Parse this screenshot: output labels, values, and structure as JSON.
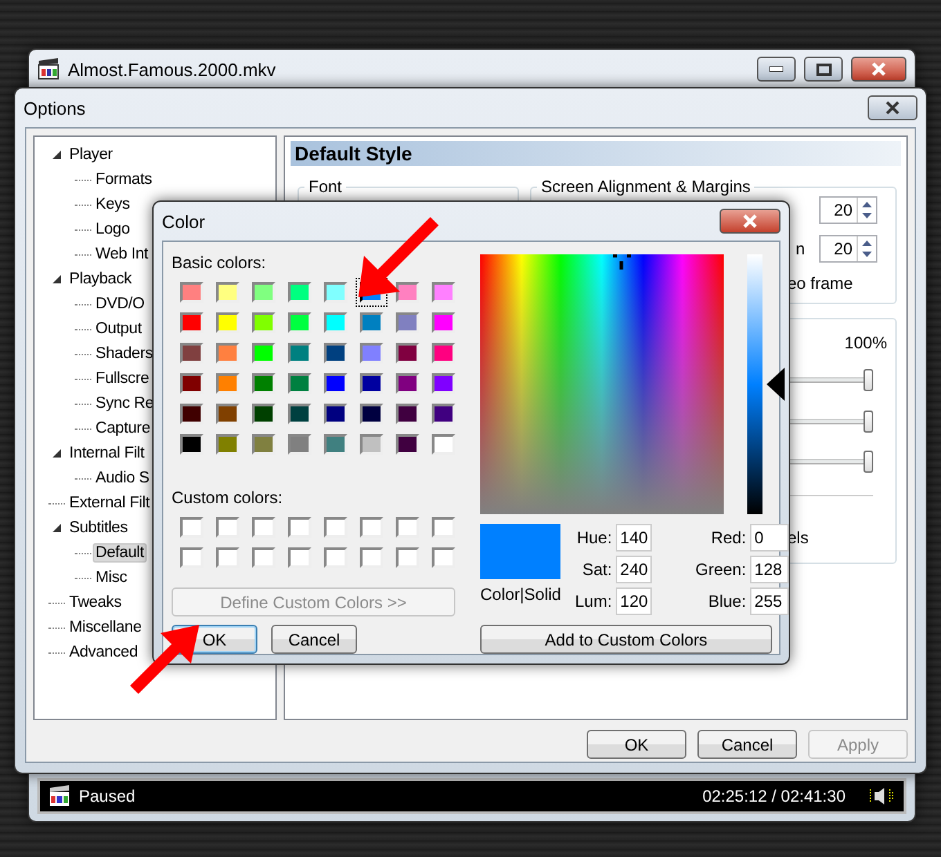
{
  "player_window": {
    "title": "Almost.Famous.2000.mkv",
    "status": "Paused",
    "time": "02:25:12 / 02:41:30"
  },
  "options_window": {
    "title": "Options",
    "tree": [
      {
        "label": "Player",
        "selected": false,
        "expanded": true,
        "children": [
          {
            "label": "Formats",
            "selected": false
          },
          {
            "label": "Keys",
            "selected": false
          },
          {
            "label": "Logo",
            "selected": false
          },
          {
            "label": "Web Int",
            "selected": false
          }
        ]
      },
      {
        "label": "Playback",
        "selected": false,
        "expanded": true,
        "children": [
          {
            "label": "DVD/O",
            "selected": false
          },
          {
            "label": "Output",
            "selected": false
          },
          {
            "label": "Shaders",
            "selected": false
          },
          {
            "label": "Fullscre",
            "selected": false
          },
          {
            "label": "Sync Re",
            "selected": false
          },
          {
            "label": "Capture",
            "selected": false
          }
        ]
      },
      {
        "label": "Internal Filt",
        "selected": false,
        "expanded": true,
        "children": [
          {
            "label": "Audio S",
            "selected": false
          }
        ]
      },
      {
        "label": "External Filt",
        "selected": false
      },
      {
        "label": "Subtitles",
        "selected": false,
        "expanded": true,
        "children": [
          {
            "label": "Default",
            "selected": true
          },
          {
            "label": "Misc",
            "selected": false
          }
        ]
      },
      {
        "label": "Tweaks",
        "selected": false
      },
      {
        "label": "Miscellane",
        "selected": false
      },
      {
        "label": "Advanced",
        "selected": false
      }
    ],
    "page": {
      "header": "Default Style",
      "font_group": {
        "label": "Font"
      },
      "alignment_group": {
        "label": "Screen Alignment & Margins",
        "spinners": [
          {
            "value": "20"
          },
          {
            "label": "n",
            "value": "20"
          }
        ],
        "checkbox_label": "eo frame"
      },
      "style_group": {
        "percent": "100%",
        "sliders": [
          {
            "level": 1
          },
          {
            "level": 1
          },
          {
            "level": 1
          }
        ],
        "label": "els"
      }
    },
    "buttons": [
      {
        "label": "OK",
        "disabled": false
      },
      {
        "label": "Cancel",
        "disabled": false
      },
      {
        "label": "Apply",
        "disabled": true
      }
    ]
  },
  "color_dialog": {
    "title": "Color",
    "basic_label": "Basic colors:",
    "basic_colors": [
      {
        "color": "#ff8080",
        "selected": false
      },
      {
        "color": "#ffff80",
        "selected": false
      },
      {
        "color": "#80ff80",
        "selected": false
      },
      {
        "color": "#00ff80",
        "selected": false
      },
      {
        "color": "#80ffff",
        "selected": false
      },
      {
        "color": "#0080ff",
        "selected": true
      },
      {
        "color": "#ff80c0",
        "selected": false
      },
      {
        "color": "#ff80ff",
        "selected": false
      },
      {
        "color": "#ff0000",
        "selected": false
      },
      {
        "color": "#ffff00",
        "selected": false
      },
      {
        "color": "#80ff00",
        "selected": false
      },
      {
        "color": "#00ff40",
        "selected": false
      },
      {
        "color": "#00ffff",
        "selected": false
      },
      {
        "color": "#0080c0",
        "selected": false
      },
      {
        "color": "#8080c0",
        "selected": false
      },
      {
        "color": "#ff00ff",
        "selected": false
      },
      {
        "color": "#804040",
        "selected": false
      },
      {
        "color": "#ff8040",
        "selected": false
      },
      {
        "color": "#00ff00",
        "selected": false
      },
      {
        "color": "#008080",
        "selected": false
      },
      {
        "color": "#004080",
        "selected": false
      },
      {
        "color": "#8080ff",
        "selected": false
      },
      {
        "color": "#800040",
        "selected": false
      },
      {
        "color": "#ff0080",
        "selected": false
      },
      {
        "color": "#800000",
        "selected": false
      },
      {
        "color": "#ff8000",
        "selected": false
      },
      {
        "color": "#008000",
        "selected": false
      },
      {
        "color": "#008040",
        "selected": false
      },
      {
        "color": "#0000ff",
        "selected": false
      },
      {
        "color": "#0000a0",
        "selected": false
      },
      {
        "color": "#800080",
        "selected": false
      },
      {
        "color": "#8000ff",
        "selected": false
      },
      {
        "color": "#400000",
        "selected": false
      },
      {
        "color": "#804000",
        "selected": false
      },
      {
        "color": "#004000",
        "selected": false
      },
      {
        "color": "#004040",
        "selected": false
      },
      {
        "color": "#000080",
        "selected": false
      },
      {
        "color": "#000040",
        "selected": false
      },
      {
        "color": "#400040",
        "selected": false
      },
      {
        "color": "#400080",
        "selected": false
      },
      {
        "color": "#000000",
        "selected": false
      },
      {
        "color": "#808000",
        "selected": false
      },
      {
        "color": "#808040",
        "selected": false
      },
      {
        "color": "#808080",
        "selected": false
      },
      {
        "color": "#408080",
        "selected": false
      },
      {
        "color": "#c0c0c0",
        "selected": false
      },
      {
        "color": "#400040",
        "selected": false
      },
      {
        "color": "#ffffff",
        "selected": false
      }
    ],
    "custom_label": "Custom colors:",
    "define_button": {
      "label": "Define Custom Colors >>",
      "disabled": true
    },
    "buttons": [
      {
        "label": "OK",
        "default": true
      },
      {
        "label": "Cancel",
        "default": false
      }
    ],
    "luminance": {
      "level": 0.5
    },
    "preview_label": "Color|Solid",
    "hsl_fields": [
      {
        "label": "Hue:",
        "value": "140"
      },
      {
        "label": "Sat:",
        "value": "240"
      },
      {
        "label": "Lum:",
        "value": "120"
      }
    ],
    "rgb_fields": [
      {
        "label": "Red:",
        "value": "0"
      },
      {
        "label": "Green:",
        "value": "128"
      },
      {
        "label": "Blue:",
        "value": "255"
      }
    ],
    "add_button": "Add to Custom Colors"
  }
}
